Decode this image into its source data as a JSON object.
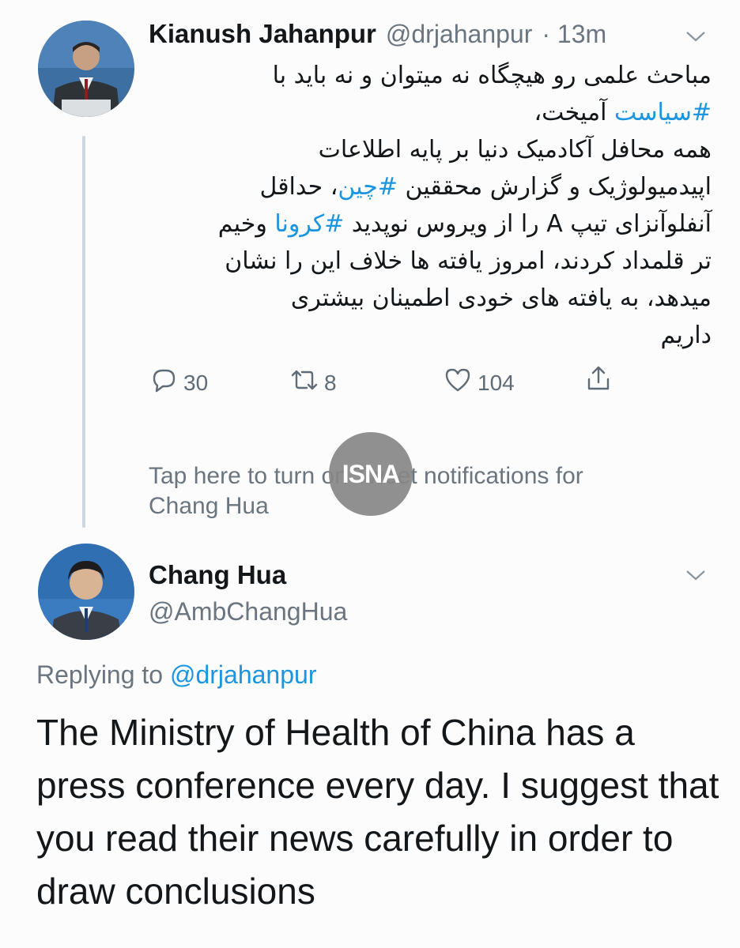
{
  "tweet1": {
    "author_name": "Kianush Jahanpur",
    "handle": "@drjahanpur",
    "time": "· 13m",
    "body_segments": [
      {
        "text": "مباحث علمی رو هیچگاه نه میتوان و نه باید با",
        "type": "text"
      },
      {
        "text": "#سیاست",
        "type": "hashtag"
      },
      {
        "text": " آمیخت،",
        "type": "text"
      },
      {
        "text": "همه محافل آکادمیک دنیا بر پایه اطلاعات",
        "type": "text"
      },
      {
        "text": "اپیدمیولوژیک و گزارش محققین ",
        "type": "text"
      },
      {
        "text": "#چین",
        "type": "hashtag"
      },
      {
        "text": "، حداقل",
        "type": "text"
      },
      {
        "text": "آنفلوآنزای تیپ A را از ویروس نوپدید ",
        "type": "text"
      },
      {
        "text": "#کرونا",
        "type": "hashtag"
      },
      {
        "text": " وخیم",
        "type": "text"
      },
      {
        "text": "تر قلمداد کردند، امروز یافته ها خلاف این را نشان",
        "type": "text"
      },
      {
        "text": "میدهد، به یافته های خودی اطمینان بیشتری",
        "type": "text"
      },
      {
        "text": "داریم",
        "type": "text"
      }
    ],
    "actions": {
      "reply_count": "30",
      "retweet_count": "8",
      "like_count": "104"
    },
    "icons": [
      "chevron-down-icon",
      "reply-icon",
      "retweet-icon",
      "like-icon",
      "share-icon"
    ]
  },
  "notification": {
    "line1": "Tap here to turn on Tweet notifications for",
    "line2": "Chang Hua"
  },
  "watermark": {
    "text": "ISNA"
  },
  "tweet2": {
    "author_name": "Chang Hua",
    "handle": "@AmbChangHua",
    "replying_prefix": "Replying to ",
    "replying_handle": "@drjahanpur",
    "body": "The Ministry of Health of China has a press conference every day. I suggest that you read their news carefully in order to draw conclusions"
  },
  "colors": {
    "link": "#1b95e0",
    "secondary_text": "#6a7580",
    "primary_text": "#14171a",
    "thread_line": "#cfd6dd"
  }
}
